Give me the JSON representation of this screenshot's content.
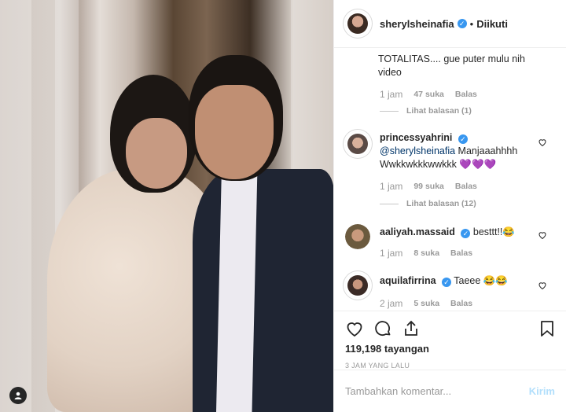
{
  "header": {
    "username": "sherylsheinafia",
    "separator": "•",
    "follow_status": "Diikuti"
  },
  "comments": [
    {
      "partial_text": "TOTALITAS.... gue puter mulu nih video",
      "time": "1 jam",
      "likes": "47 suka",
      "reply": "Balas",
      "view_replies": "Lihat balasan (1)"
    },
    {
      "username": "princessyahrini",
      "verified": true,
      "mention": "@sherylsheinafia",
      "text": " Manjaaahhhh Wwkkwkkkwwkkk ",
      "emoji": "💜💜💜",
      "time": "1 jam",
      "likes": "99 suka",
      "reply": "Balas",
      "view_replies": "Lihat balasan (12)"
    },
    {
      "username": "aaliyah.massaid",
      "verified": true,
      "text": "besttt!!😂",
      "time": "1 jam",
      "likes": "8 suka",
      "reply": "Balas"
    },
    {
      "username": "aquilafirrina",
      "verified": true,
      "text": "Taeee 😂😂",
      "time": "2 jam",
      "likes": "5 suka",
      "reply": "Balas"
    }
  ],
  "stats": {
    "views": "119,198 tayangan",
    "time_ago": "3 JAM YANG LALU"
  },
  "add_comment": {
    "placeholder": "Tambahkan komentar...",
    "post_label": "Kirim"
  },
  "icons": {
    "like": "heart-icon",
    "comment": "comment-icon",
    "share": "share-icon",
    "save": "bookmark-icon",
    "verified": "verified-badge-icon",
    "user": "user-tag-icon"
  },
  "colors": {
    "link": "#003569",
    "verified": "#3897f0",
    "muted": "#999999",
    "post_disabled": "#b2dffc"
  }
}
